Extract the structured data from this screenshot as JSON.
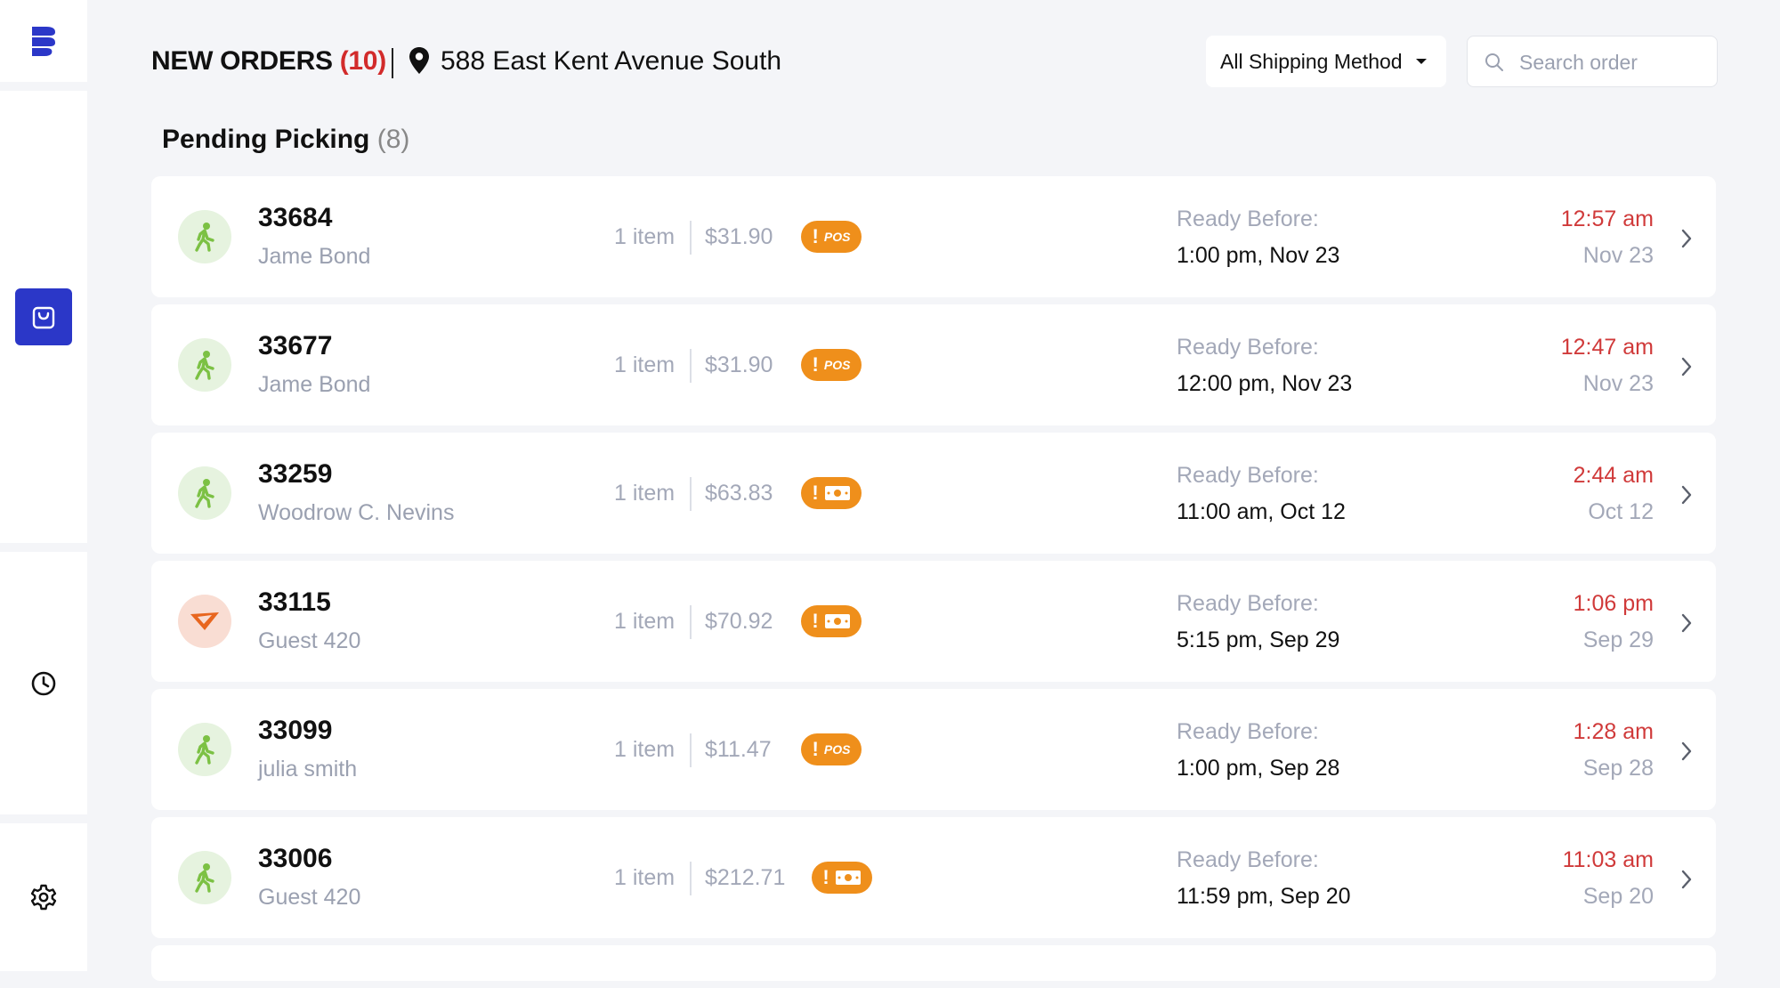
{
  "header": {
    "title": "NEW ORDERS",
    "count": "(10)",
    "address": "588 East Kent Avenue South",
    "shipping_filter": "All Shipping Method",
    "search_placeholder": "Search order"
  },
  "section": {
    "title": "Pending Picking",
    "count": "(8)"
  },
  "colors": {
    "accent": "#2b37c8",
    "urgent": "#d03a3a",
    "badge": "#ef8f1b",
    "pickup": "#7cc144",
    "delivery": "#e8661f"
  },
  "orders": [
    {
      "id": "33684",
      "customer": "Jame Bond",
      "items": "1 item",
      "price": "$31.90",
      "method": "pickup",
      "badge": "POS",
      "ready_label": "Ready Before:",
      "ready_time": "1:00 pm, Nov 23",
      "time": "12:57 am",
      "date": "Nov 23"
    },
    {
      "id": "33677",
      "customer": "Jame Bond",
      "items": "1 item",
      "price": "$31.90",
      "method": "pickup",
      "badge": "POS",
      "ready_label": "Ready Before:",
      "ready_time": "12:00 pm, Nov 23",
      "time": "12:47 am",
      "date": "Nov 23"
    },
    {
      "id": "33259",
      "customer": "Woodrow C. Nevins",
      "items": "1 item",
      "price": "$63.83",
      "method": "pickup",
      "badge": "cash",
      "ready_label": "Ready Before:",
      "ready_time": "11:00 am, Oct 12",
      "time": "2:44 am",
      "date": "Oct 12"
    },
    {
      "id": "33115",
      "customer": "Guest 420",
      "items": "1 item",
      "price": "$70.92",
      "method": "delivery",
      "badge": "cash",
      "ready_label": "Ready Before:",
      "ready_time": "5:15 pm, Sep 29",
      "time": "1:06 pm",
      "date": "Sep 29"
    },
    {
      "id": "33099",
      "customer": "julia smith",
      "items": "1 item",
      "price": "$11.47",
      "method": "pickup",
      "badge": "POS",
      "ready_label": "Ready Before:",
      "ready_time": "1:00 pm, Sep 28",
      "time": "1:28 am",
      "date": "Sep 28"
    },
    {
      "id": "33006",
      "customer": "Guest 420",
      "items": "1 item",
      "price": "$212.71",
      "method": "pickup",
      "badge": "cash",
      "ready_label": "Ready Before:",
      "ready_time": "11:59 pm, Sep 20",
      "time": "11:03 am",
      "date": "Sep 20"
    }
  ]
}
